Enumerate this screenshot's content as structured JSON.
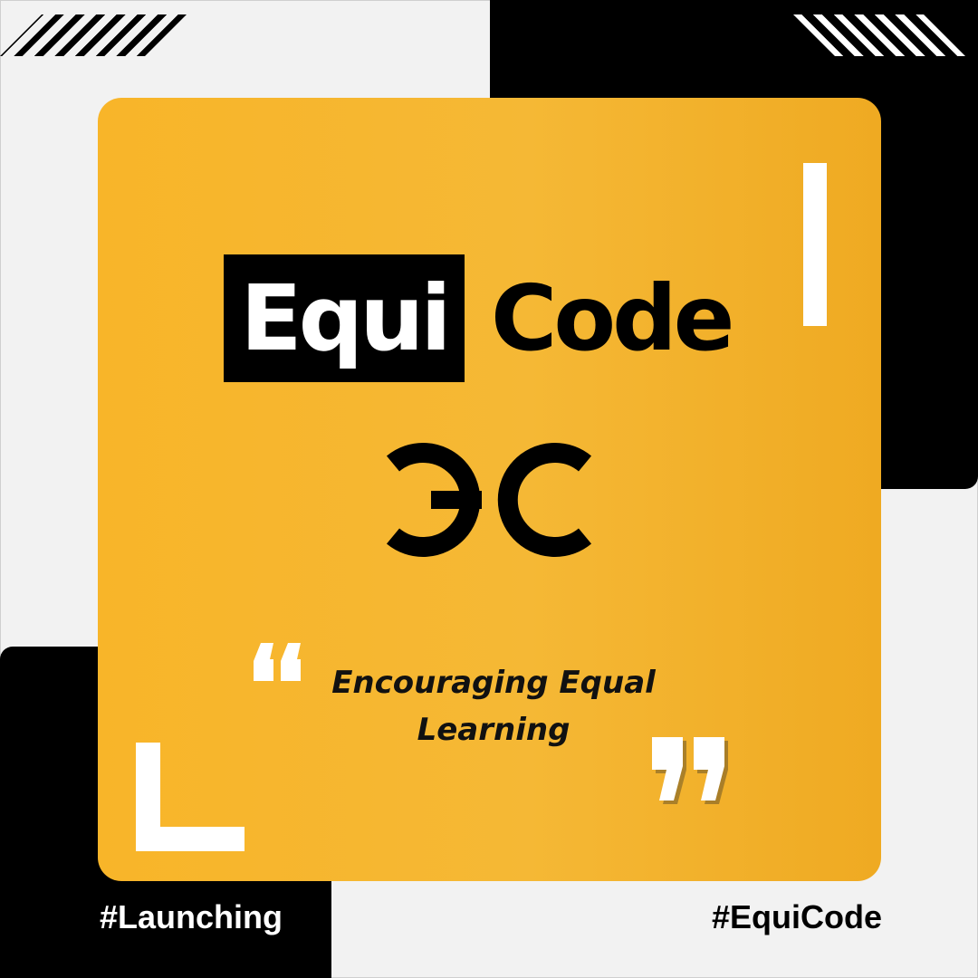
{
  "brand": {
    "word_left": "Equi",
    "word_right": "Code"
  },
  "tagline": {
    "line1": "Encouraging Equal",
    "line2": "Learning"
  },
  "hashtags": {
    "left": "#Launching",
    "right": "#EquiCode"
  },
  "colors": {
    "card_gradient_start": "#f8b529",
    "card_gradient_end": "#efaa22",
    "black": "#000000",
    "white": "#ffffff",
    "background": "#f2f2f2"
  },
  "icons": {
    "logo_mark": "ec-logo-icon",
    "open_quote": "open-quote-icon",
    "close_quote": "close-quote-icon"
  }
}
